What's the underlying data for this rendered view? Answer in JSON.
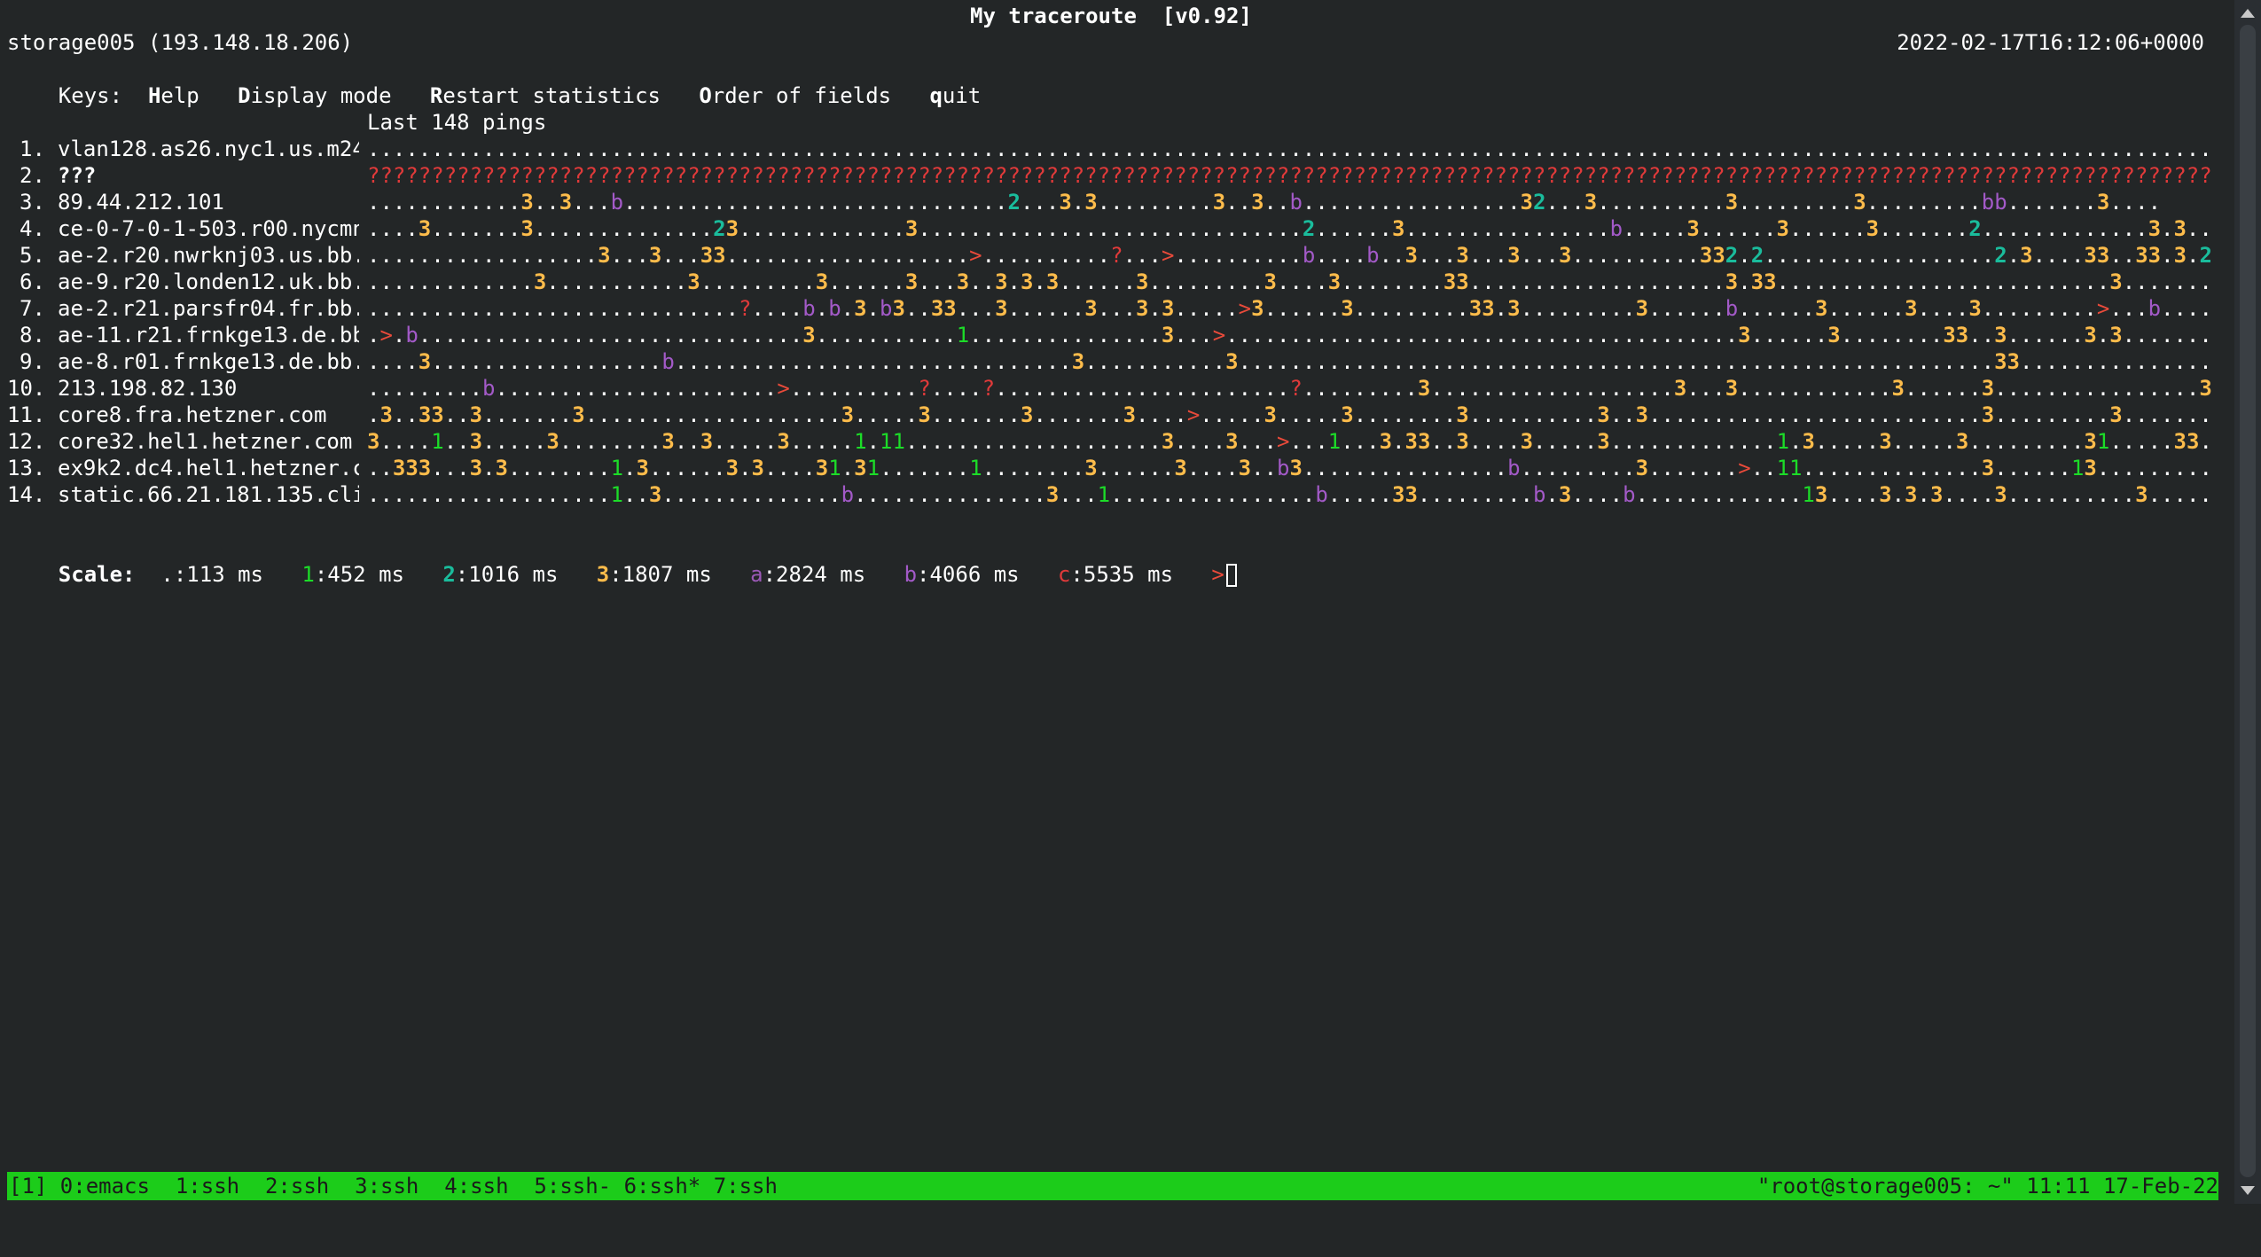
{
  "title": "My traceroute  [v0.92]",
  "host_line": "storage005 (193.148.18.206)",
  "timestamp": "2022-02-17T16:12:06+0000",
  "keys": {
    "label": "Keys:",
    "items": [
      {
        "key": "H",
        "rest": "elp"
      },
      {
        "key": "D",
        "rest": "isplay mode"
      },
      {
        "key": "R",
        "rest": "estart statistics"
      },
      {
        "key": "O",
        "rest": "rder of fields"
      },
      {
        "key": "q",
        "rest": "uit"
      }
    ]
  },
  "pings_header": "Last 148 pings",
  "hops": [
    {
      "num": "1.",
      "host": "vlan128.as26.nyc1.us.m24",
      "bold": false,
      "pings": "...................................................................................................................................................."
    },
    {
      "num": "2.",
      "host": "???",
      "bold": true,
      "pings": "????????????????????????????????????????????????????????????????????????????????????????????????????????????????????????????????????????????????????"
    },
    {
      "num": "3.",
      "host": "89.44.212.101",
      "bold": false,
      "pings": "............3..3...b..............................2...3.3.........3..3..b.................32...3..........3.........3.........bb.......3...."
    },
    {
      "num": "4.",
      "host": "ce-0-7-0-1-503.r00.nycmn",
      "bold": false,
      "pings": "....3.......3..............23.............3..............................2......3................b.....3......3......3.......2.............3.3..3.."
    },
    {
      "num": "5.",
      "host": "ae-2.r20.nwrknj03.us.bb.",
      "bold": false,
      "pings": "..................3...3...33...................>..........?...>..........b....b..3...3...3...3..........332.2..................2.3....33..33.3.2....2..."
    },
    {
      "num": "6.",
      "host": "ae-9.r20.londen12.uk.bb.",
      "bold": false,
      "pings": ".............3...........3.........3......3...3..3.3.3......3.........3....3........33....................3.33..........................3..................3..."
    },
    {
      "num": "7.",
      "host": "ae-2.r21.parsfr04.fr.bb.",
      "bold": false,
      "pings": ".............................?....b.b.3.b3..33...3......3...3.3.....>3......3.........33.3.........3......b......3......3....3.........>...b.....b...3..."
    },
    {
      "num": "8.",
      "host": "ae-11.r21.frnkge13.de.bb",
      "bold": false,
      "pings": ".>.b..............................3...........1...............3...>........................................3......3........33..3......3.3.............."
    },
    {
      "num": "9.",
      "host": "ae-8.r01.frnkge13.de.bb.",
      "bold": false,
      "pings": "....3..................b...............................3...........3...........................................................33................"
    },
    {
      "num": "10.",
      "host": "213.198.82.130",
      "bold": false,
      "pings": ".........b......................>..........?....?.......................?.........3...................3...3............3......3................3..3...?"
    },
    {
      "num": "11.",
      "host": "core8.fra.hetzner.com",
      "bold": false,
      "pings": ".3..33..3.......3....................3.....3.......3.......3....>.....3.....3........3..........3..3..........................3.........3.........?"
    },
    {
      "num": "12.",
      "host": "core32.hel1.hetzner.com",
      "bold": false,
      "pings": "3....1..3.....3........3..3.....3.....1.11....................3....3...>...1...3.33..3....3.....3.............1.3.....3.....3.........31.....33........"
    },
    {
      "num": "13.",
      "host": "ex9k2.dc4.hel1.hetzner.c",
      "bold": false,
      "pings": "..333...3.3........1.3......3.3....31.31.......1........3......3....3..b3................b.........3.......>..11..............3......13............"
    },
    {
      "num": "14.",
      "host": "static.66.21.181.135.cli",
      "bold": false,
      "pings": "...................1..3..............b...............3...1................b.....33.........b.3....b.............13....3.3.3....3..........3.........."
    }
  ],
  "scale": {
    "label": "Scale:",
    "items": [
      {
        "sym": ".",
        "value": ":113 ms",
        "cls": "c-dot"
      },
      {
        "sym": "1",
        "value": ":452 ms",
        "cls": "c-1"
      },
      {
        "sym": "2",
        "value": ":1016 ms",
        "cls": "c-2"
      },
      {
        "sym": "3",
        "value": ":1807 ms",
        "cls": "c-3"
      },
      {
        "sym": "a",
        "value": ":2824 ms",
        "cls": "c-a"
      },
      {
        "sym": "b",
        "value": ":4066 ms",
        "cls": "c-b"
      },
      {
        "sym": "c",
        "value": ":5535 ms",
        "cls": "c-c"
      },
      {
        "sym": ">",
        "value": "",
        "cls": "c-gt"
      }
    ]
  },
  "statusbar": {
    "left": "[1] 0:emacs  1:ssh  2:ssh  3:ssh  4:ssh  5:ssh- 6:ssh* 7:ssh",
    "right": "\"root@storage005: ~\" 11:11 17-Feb-22"
  },
  "colors": {
    "background": "#232627",
    "status_green": "#1ccc1a",
    "ping_3": "#fdbc4b",
    "ping_2": "#1abc9c",
    "ping_1": "#1cdc28",
    "ping_b": "#a35ac8",
    "unknown": "#e03a3a"
  }
}
